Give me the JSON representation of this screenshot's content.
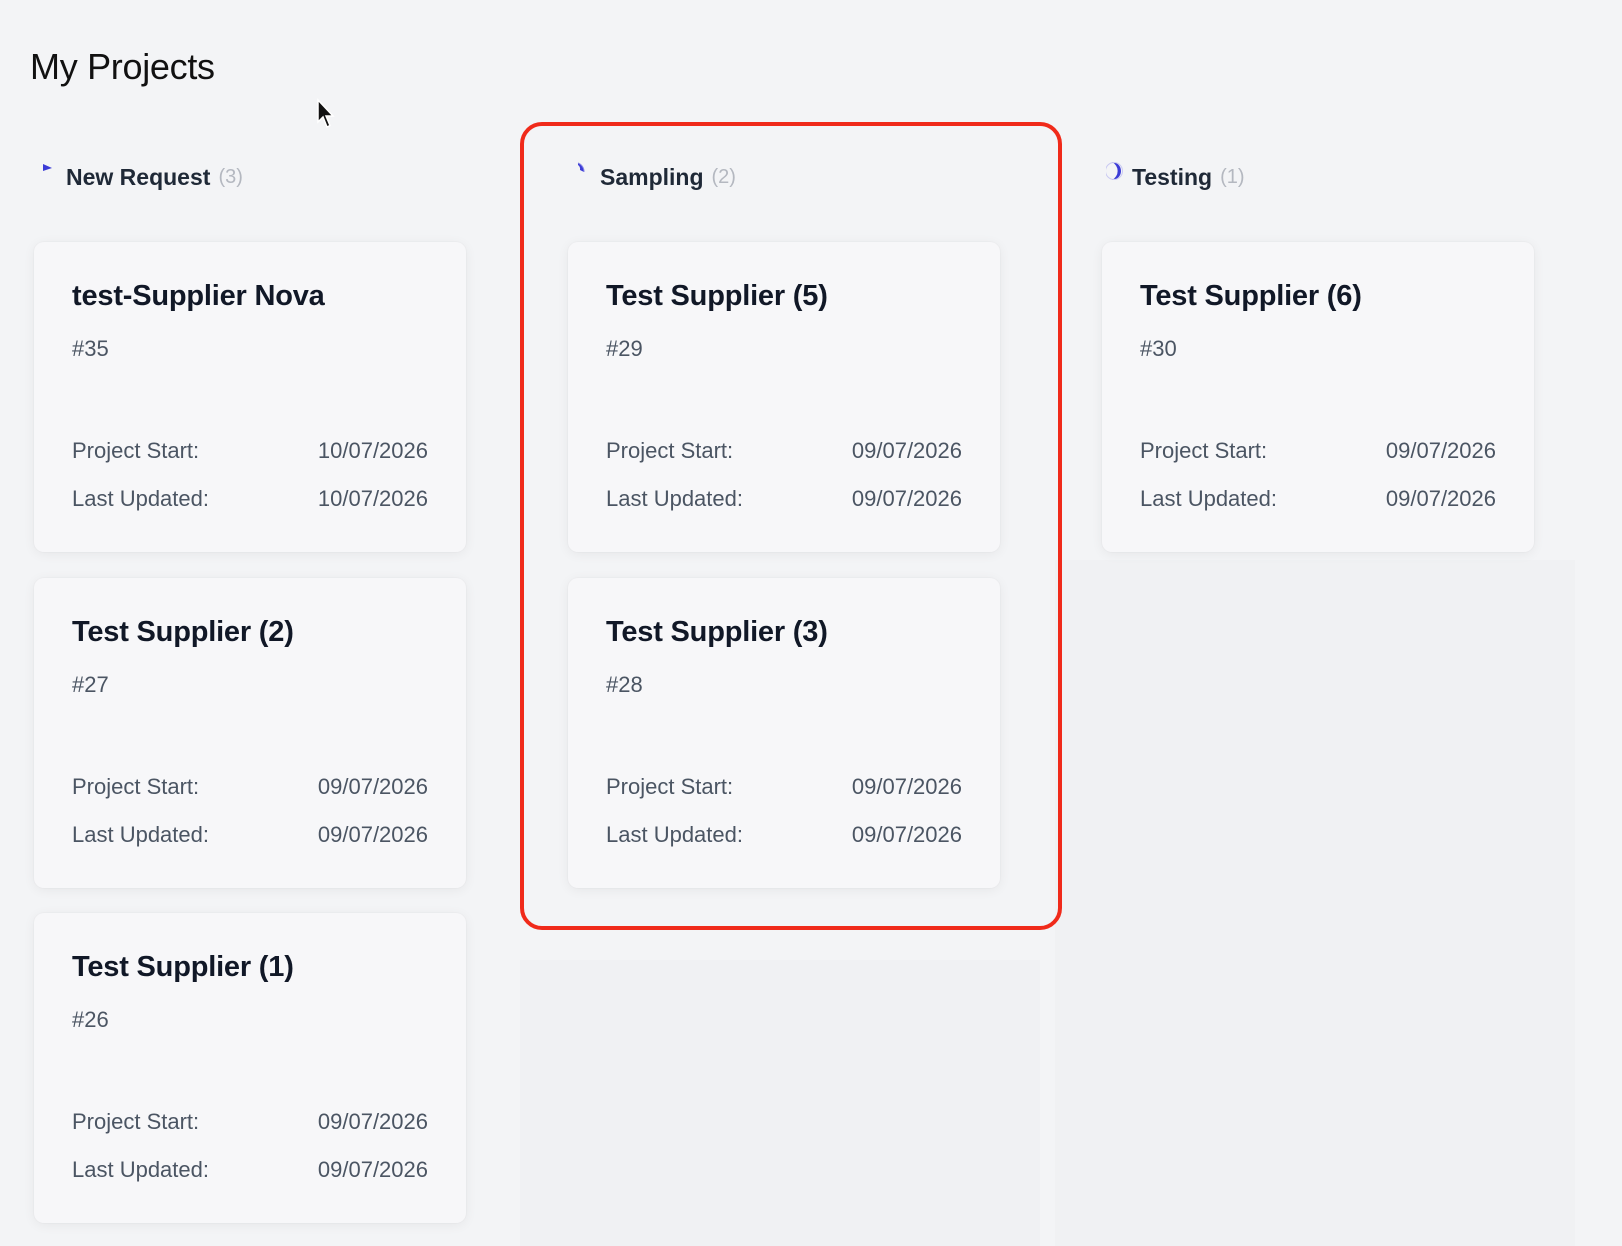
{
  "page": {
    "title": "My Projects"
  },
  "colors": {
    "background": "#f3f4f6",
    "card": "#f7f7f9",
    "highlight": "#f02a1a",
    "icon_blue": "#3b3bd6"
  },
  "columns": [
    {
      "title": "New Request",
      "count": "(3)",
      "icon": "status-new-icon",
      "cards": [
        {
          "title": "test-Supplier Nova",
          "id": "#35",
          "start_label": "Project Start:",
          "start": "10/07/2026",
          "updated_label": "Last Updated:",
          "updated": "10/07/2026"
        },
        {
          "title": "Test Supplier (2)",
          "id": "#27",
          "start_label": "Project Start:",
          "start": "09/07/2026",
          "updated_label": "Last Updated:",
          "updated": "09/07/2026"
        },
        {
          "title": "Test Supplier (1)",
          "id": "#26",
          "start_label": "Project Start:",
          "start": "09/07/2026",
          "updated_label": "Last Updated:",
          "updated": "09/07/2026"
        }
      ]
    },
    {
      "title": "Sampling",
      "count": "(2)",
      "icon": "status-sampling-icon",
      "cards": [
        {
          "title": "Test Supplier (5)",
          "id": "#29",
          "start_label": "Project Start:",
          "start": "09/07/2026",
          "updated_label": "Last Updated:",
          "updated": "09/07/2026"
        },
        {
          "title": "Test Supplier (3)",
          "id": "#28",
          "start_label": "Project Start:",
          "start": "09/07/2026",
          "updated_label": "Last Updated:",
          "updated": "09/07/2026"
        }
      ]
    },
    {
      "title": "Testing",
      "count": "(1)",
      "icon": "status-testing-icon",
      "cards": [
        {
          "title": "Test Supplier (6)",
          "id": "#30",
          "start_label": "Project Start:",
          "start": "09/07/2026",
          "updated_label": "Last Updated:",
          "updated": "09/07/2026"
        }
      ]
    }
  ]
}
